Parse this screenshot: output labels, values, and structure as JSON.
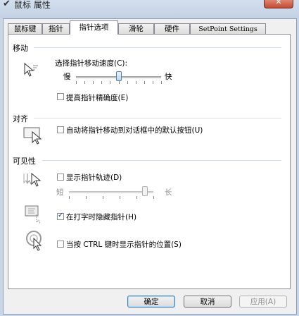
{
  "window": {
    "title": "鼠标 属性",
    "close_glyph": "✕"
  },
  "tabs": [
    {
      "label": "鼠标键"
    },
    {
      "label": "指针"
    },
    {
      "label": "指针选项",
      "active": true
    },
    {
      "label": "滑轮"
    },
    {
      "label": "硬件"
    },
    {
      "label": "SetPoint Settings"
    }
  ],
  "motion": {
    "heading": "移动",
    "speed_label": "选择指针移动速度(C):",
    "slow": "慢",
    "fast": "快",
    "speed_level": 0.5,
    "precision_label": "提高指针精确度(E)",
    "precision_checked": false
  },
  "snap": {
    "heading": "对齐",
    "label": "自动将指针移动到对话框中的默认按钮(U)",
    "checked": false
  },
  "visibility": {
    "heading": "可见性",
    "trails_label": "显示指针轨迹(D)",
    "trails_checked": false,
    "short": "短",
    "long": "长",
    "trail_level": 0.9,
    "hide_label": "在打字时隐藏指针(H)",
    "hide_checked": true,
    "ctrl_label": "当按 CTRL 键时显示指针的位置(S)",
    "ctrl_checked": false
  },
  "buttons": {
    "ok": "确定",
    "cancel": "取消",
    "apply": "应用(A)"
  },
  "icons": {
    "title": "mouse-icon",
    "motion": "pointer-motion-icon",
    "snap": "snap-to-button-icon",
    "trails": "pointer-trails-icon",
    "hide": "hide-pointer-icon",
    "ctrl": "ctrl-locate-icon"
  }
}
